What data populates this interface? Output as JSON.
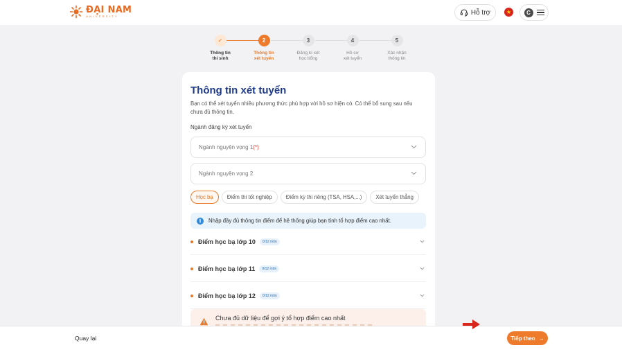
{
  "header": {
    "logo_name": "ĐẠI NAM",
    "logo_sub": "UNIVERSITY",
    "support_label": "Hỗ trợ",
    "avatar_initial": "C"
  },
  "stepper": {
    "steps": [
      {
        "number": "✓",
        "label_line1": "Thông tin",
        "label_line2": "thí sinh",
        "state": "done"
      },
      {
        "number": "2",
        "label_line1": "Thông tin",
        "label_line2": "xét tuyển",
        "state": "active"
      },
      {
        "number": "3",
        "label_line1": "Đăng kí xét",
        "label_line2": "học bổng",
        "state": "todo"
      },
      {
        "number": "4",
        "label_line1": "Hồ sơ",
        "label_line2": "xét tuyển",
        "state": "todo"
      },
      {
        "number": "5",
        "label_line1": "Xác nhận",
        "label_line2": "thông tin",
        "state": "todo"
      }
    ]
  },
  "form": {
    "title": "Thông tin xét tuyển",
    "description": "Bạn có thể xét tuyển nhiều phương thức phù hợp với hồ sơ hiện có. Có thể bổ sung sau nếu chưa đủ thông tin.",
    "section_label": "Ngành đăng ký xét tuyển",
    "major1_placeholder": "Ngành nguyện vọng 1",
    "major1_required": "(*)",
    "major2_placeholder": "Ngành nguyện vọng 2",
    "tabs": [
      "Học bạ",
      "Điểm thi tốt nghiệp",
      "Điểm kỳ thi riêng (TSA, HSA,...)",
      "Xét tuyển thẳng"
    ],
    "active_tab": "Học bạ",
    "info_text": "Nhập đầy đủ thông tin điểm để hệ thống giúp bạn tính tổ hợp điểm cao nhất.",
    "grades": [
      {
        "title": "Điểm học bạ lớp 10",
        "badge": "0/12 môn"
      },
      {
        "title": "Điểm học bạ lớp 11",
        "badge": "0/12 môn"
      },
      {
        "title": "Điểm học bạ lớp 12",
        "badge": "0/12 môn"
      }
    ],
    "warning_title": "Chưa đủ dữ liệu để gợi ý tổ hợp điểm cao nhất"
  },
  "footer": {
    "back_label": "Quay lại",
    "next_label": "Tiếp theo"
  },
  "colors": {
    "accent": "#ee7a2b",
    "title_blue": "#1e3a8a",
    "info_bg": "#e8f3fb",
    "warning_bg": "#fdf0ea",
    "annotation_arrow": "#d9261c"
  }
}
